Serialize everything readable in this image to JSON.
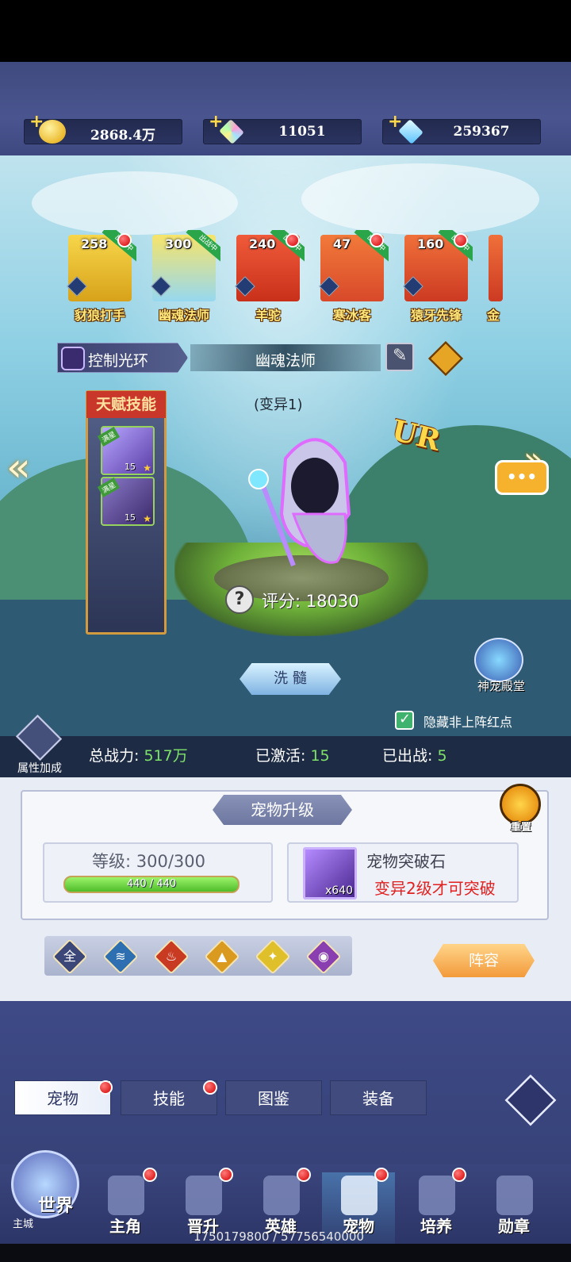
{
  "resources": [
    {
      "icon": "gold-coin-icon",
      "value": "2868.4万"
    },
    {
      "icon": "rainbow-gem-icon",
      "value": "11051"
    },
    {
      "icon": "diamond-icon",
      "value": "259367"
    }
  ],
  "pets": [
    {
      "level": "258",
      "name": "豺狼打手",
      "deployed": true,
      "red_dot": true,
      "color": "#f2c12e"
    },
    {
      "level": "300",
      "name": "幽魂法师",
      "deployed": true,
      "red_dot": false,
      "color": "#f2c12e"
    },
    {
      "level": "240",
      "name": "羊驼",
      "deployed": true,
      "red_dot": true,
      "color": "#e0452a"
    },
    {
      "level": "47",
      "name": "寒冰客",
      "deployed": true,
      "red_dot": true,
      "color": "#e0452a"
    },
    {
      "level": "160",
      "name": "猿牙先锋",
      "deployed": true,
      "red_dot": true,
      "color": "#e0452a"
    },
    {
      "level": "",
      "name": "金",
      "deployed": false,
      "red_dot": false,
      "color": "#e0452a"
    }
  ],
  "deployed_ribbon": "出战中",
  "skill": {
    "label": "控制光环",
    "pet_name": "幽魂法师"
  },
  "mutation": "(变异1)",
  "rarity": "UR",
  "talent": {
    "title": "天赋技能",
    "skills": [
      {
        "tag": "满星",
        "level": "15"
      },
      {
        "tag": "满星",
        "level": "15"
      }
    ]
  },
  "score": {
    "label": "评分:",
    "value": "18030"
  },
  "wash_button": "洗 髓",
  "shrine_label": "神宠殿堂",
  "hide_red_dots": {
    "label": "隐藏非上阵红点",
    "checked": true
  },
  "attr_bonus_label": "属性加成",
  "stats": {
    "power_label": "总战力:",
    "power": "517万",
    "active_label": "已激活:",
    "active": "15",
    "deployed_label": "已出战:",
    "deployed": "5"
  },
  "upgrade": {
    "title": "宠物升级",
    "reset_label": "重置",
    "level_label": "等级:",
    "level_value": "300/300",
    "exp_text": "440 / 440",
    "exp_fraction": 1.0,
    "item_name": "宠物突破石",
    "item_count": "x640",
    "notice": "变异2级才可突破"
  },
  "filters": [
    {
      "icon": "all-filter",
      "label": "全"
    },
    {
      "icon": "water-element-icon",
      "label": "≋"
    },
    {
      "icon": "fire-element-icon",
      "label": "♨"
    },
    {
      "icon": "earth-element-icon",
      "label": "▲"
    },
    {
      "icon": "light-element-icon",
      "label": "✦"
    },
    {
      "icon": "dark-element-icon",
      "label": "◉"
    }
  ],
  "lineup_button": "阵容",
  "subtabs": [
    {
      "label": "宠物",
      "active": true,
      "red_dot": true
    },
    {
      "label": "技能",
      "active": false,
      "red_dot": true
    },
    {
      "label": "图鉴",
      "active": false,
      "red_dot": false
    },
    {
      "label": "装备",
      "active": false,
      "red_dot": false
    }
  ],
  "world": {
    "label": "世界",
    "sub": "主城"
  },
  "nav": [
    {
      "label": "主角",
      "red_dot": true,
      "active": false
    },
    {
      "label": "晋升",
      "red_dot": true,
      "active": false
    },
    {
      "label": "英雄",
      "red_dot": true,
      "active": false
    },
    {
      "label": "宠物",
      "red_dot": true,
      "active": true
    },
    {
      "label": "培养",
      "red_dot": true,
      "active": false
    },
    {
      "label": "勋章",
      "red_dot": false,
      "active": false
    }
  ],
  "footer_ids": "1750179800 / 57756540000"
}
